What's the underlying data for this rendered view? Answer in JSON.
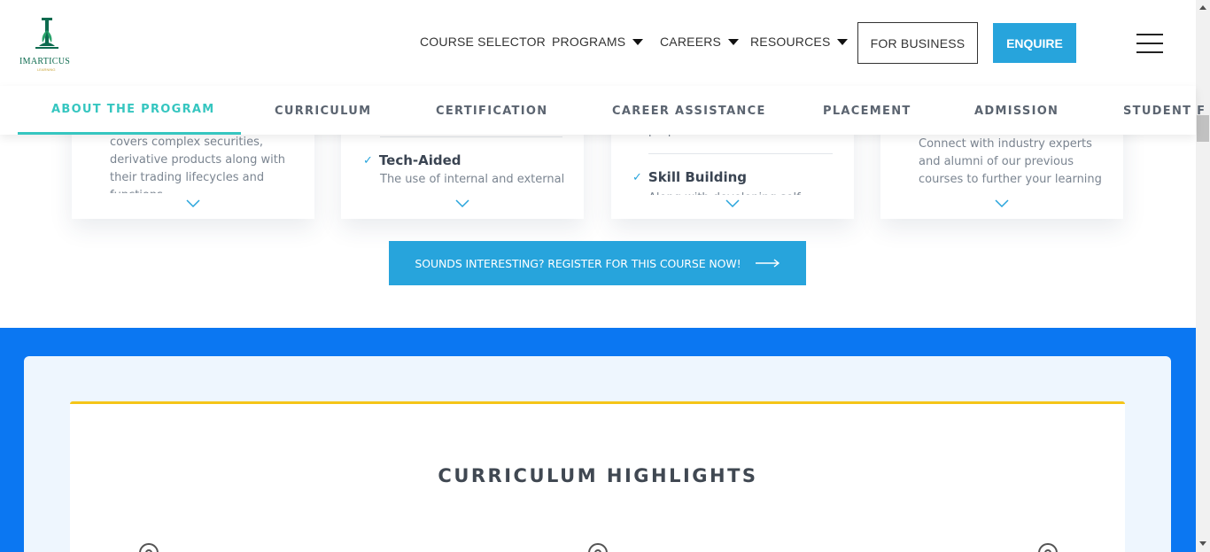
{
  "header": {
    "logo_text": "IMARTICUS",
    "logo_subtext": "LEARNING",
    "nav": [
      {
        "label": "COURSE SELECTOR",
        "has_caret": false
      },
      {
        "label": "PROGRAMS",
        "has_caret": true
      },
      {
        "label": "CAREERS",
        "has_caret": true
      },
      {
        "label": "RESOURCES",
        "has_caret": true
      }
    ],
    "for_business_label": "FOR BUSINESS",
    "enquire_label": "ENQUIRE",
    "menu_icon": "hamburger-icon"
  },
  "tabs": [
    {
      "label": "ABOUT THE PROGRAM",
      "active": true
    },
    {
      "label": "CURRICULUM",
      "active": false
    },
    {
      "label": "CERTIFICATION",
      "active": false
    },
    {
      "label": "CAREER ASSISTANCE",
      "active": false
    },
    {
      "label": "PLACEMENT",
      "active": false
    },
    {
      "label": "ADMISSION",
      "active": false
    },
    {
      "label": "STUDENT F",
      "active": false
    }
  ],
  "cards": [
    {
      "text_lines": [
        "covers complex securities,",
        "derivative products along with",
        "their trading lifecycles and",
        "functions"
      ]
    },
    {
      "heading": "Tech-Aided",
      "text_lines": [
        "The use of internal and external"
      ]
    },
    {
      "top_fragment": "purpose",
      "heading": "Skill Building",
      "text_lines": [
        "Along with developing self"
      ]
    },
    {
      "text_lines": [
        "Connect with industry experts",
        "and alumni of our previous",
        "courses to further your learning"
      ]
    }
  ],
  "cta": {
    "label": "SOUNDS INTERESTING? REGISTER FOR THIS COURSE NOW!",
    "icon": "arrow-right-icon"
  },
  "highlights": {
    "title": "CURRICULUM HIGHLIGHTS"
  },
  "colors": {
    "accent": "#27a4dc",
    "tab_active": "#36c6c0",
    "band": "#0b77f2",
    "highlight_border": "#f5c518",
    "brand": "#0d6b4f"
  }
}
